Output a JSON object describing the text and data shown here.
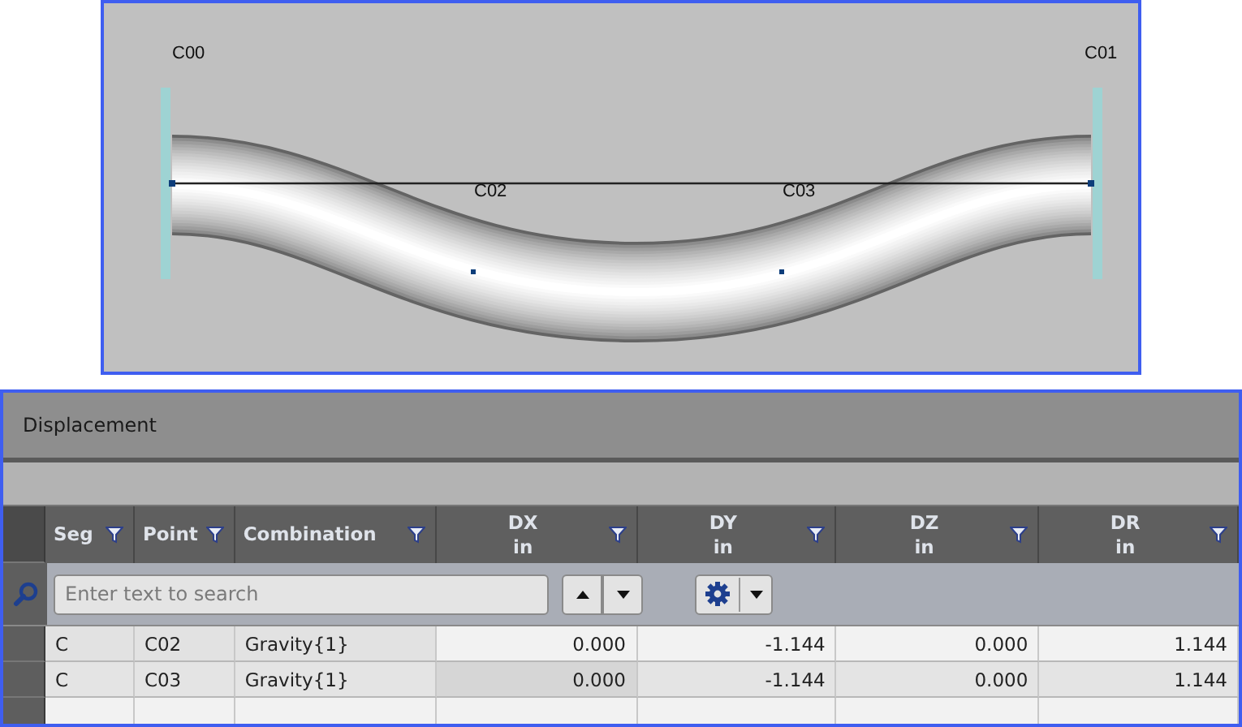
{
  "viewport": {
    "nodes": [
      {
        "label": "C00",
        "kind": "support"
      },
      {
        "label": "C01",
        "kind": "support"
      },
      {
        "label": "C02",
        "kind": "point"
      },
      {
        "label": "C03",
        "kind": "point"
      }
    ]
  },
  "panel": {
    "title": "Displacement"
  },
  "table": {
    "columns": [
      {
        "name": "Seg"
      },
      {
        "name": "Point"
      },
      {
        "name": "Combination"
      },
      {
        "name": "DX",
        "unit": "in"
      },
      {
        "name": "DY",
        "unit": "in"
      },
      {
        "name": "DZ",
        "unit": "in"
      },
      {
        "name": "DR",
        "unit": "in"
      }
    ],
    "search": {
      "placeholder": "Enter text to search"
    },
    "rows": [
      [
        "C",
        "C02",
        "Gravity{1}",
        "0.000",
        "-1.144",
        "0.000",
        "1.144"
      ],
      [
        "C",
        "C03",
        "Gravity{1}",
        "0.000",
        "-1.144",
        "0.000",
        "1.144"
      ]
    ]
  }
}
